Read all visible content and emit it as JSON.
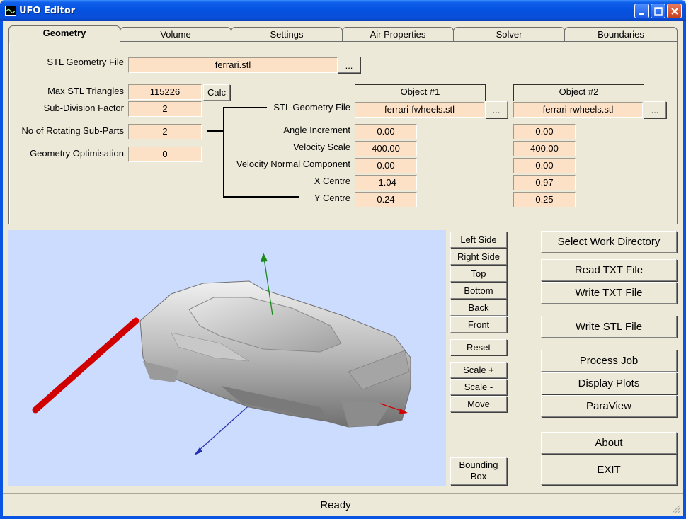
{
  "window": {
    "title": "UFO Editor"
  },
  "tabs": [
    "Geometry",
    "Volume",
    "Settings",
    "Air Properties",
    "Solver",
    "Boundaries"
  ],
  "geometry": {
    "stl_file_label": "STL Geometry File",
    "stl_file_value": "ferrari.stl",
    "browse_label": "...",
    "max_triangles_label": "Max STL Triangles",
    "max_triangles_value": "115226",
    "calc_label": "Calc",
    "subdivision_label": "Sub-Division Factor",
    "subdivision_value": "2",
    "rotating_label": "No of Rotating Sub-Parts",
    "rotating_value": "2",
    "optimisation_label": "Geometry Optimisation",
    "optimisation_value": "0",
    "row_labels": {
      "stl": "STL Geometry File",
      "angle": "Angle Increment",
      "velscale": "Velocity Scale",
      "velnormal": "Velocity Normal Component",
      "xcentre": "X Centre",
      "ycentre": "Y Centre"
    },
    "objects": [
      {
        "header": "Object #1",
        "stl": "ferrari-fwheels.stl",
        "angle": "0.00",
        "velscale": "400.00",
        "velnormal": "0.00",
        "xcentre": "-1.04",
        "ycentre": "0.24"
      },
      {
        "header": "Object #2",
        "stl": "ferrari-rwheels.stl",
        "angle": "0.00",
        "velscale": "400.00",
        "velnormal": "0.00",
        "xcentre": "0.97",
        "ycentre": "0.25"
      }
    ]
  },
  "view_buttons": {
    "left": "Left Side",
    "right": "Right Side",
    "top": "Top",
    "bottom": "Bottom",
    "back": "Back",
    "front": "Front",
    "reset": "Reset",
    "scale_plus": "Scale +",
    "scale_minus": "Scale -",
    "move": "Move",
    "bbox_line1": "Bounding",
    "bbox_line2": "Box"
  },
  "actions": {
    "select_dir": "Select Work Directory",
    "read_txt": "Read TXT File",
    "write_txt": "Write TXT File",
    "write_stl": "Write STL File",
    "process": "Process Job",
    "display_plots": "Display Plots",
    "paraview": "ParaView",
    "about": "About",
    "exit": "EXIT"
  },
  "status": {
    "text": "Ready"
  },
  "colors": {
    "field_bg": "#fde1c6",
    "viewport_bg": "#ccdcff",
    "titlebar": "#0551e0"
  }
}
